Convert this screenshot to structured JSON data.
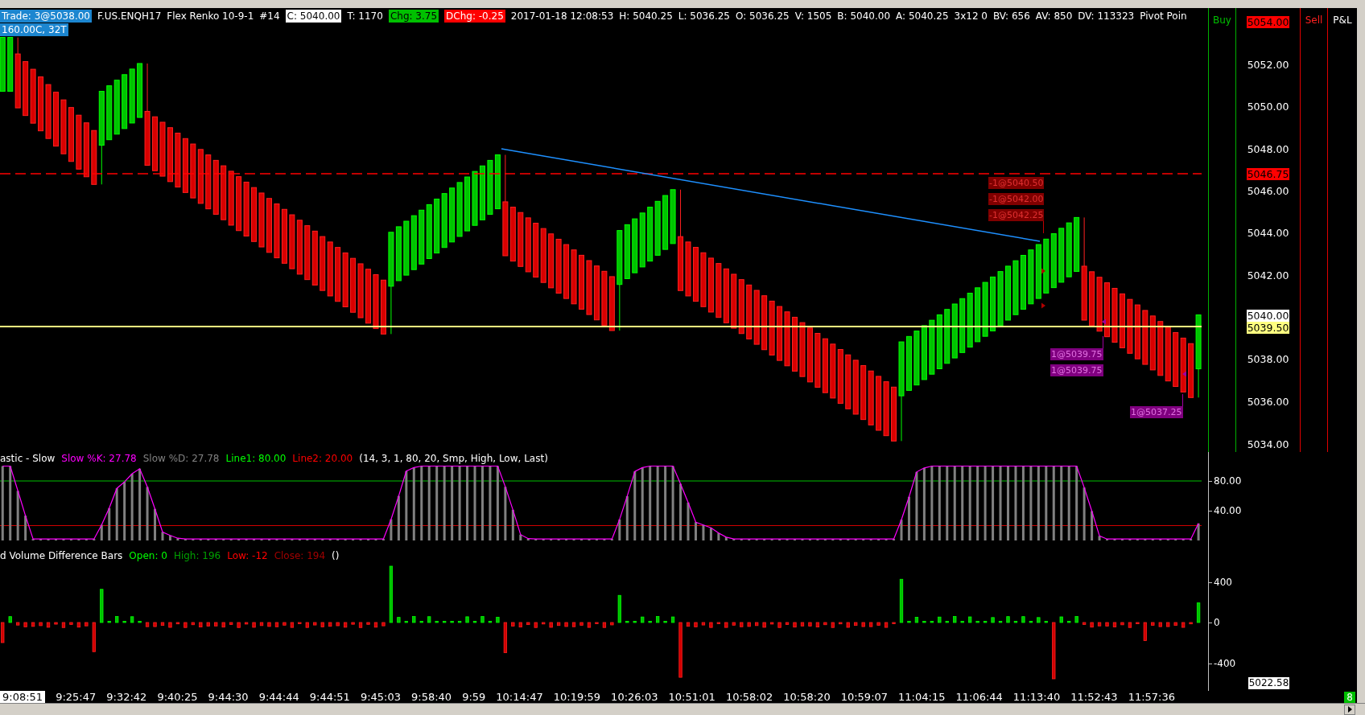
{
  "header": {
    "fields": [
      {
        "text": "Trade: 3@5038.00",
        "kind": "tag",
        "color": "#1c86d0"
      },
      {
        "text": "F.US.ENQH17",
        "kind": "text"
      },
      {
        "text": "Flex Renko 10-9-1",
        "kind": "text"
      },
      {
        "text": "#14",
        "kind": "text"
      },
      {
        "text": "C: 5040.00",
        "kind": "tag",
        "color": "#ffffff"
      },
      {
        "text": "T: 1170",
        "kind": "text"
      },
      {
        "text": "Chg: 3.75",
        "kind": "tag",
        "color": "#00c000"
      },
      {
        "text": "DChg: -0.25",
        "kind": "tag",
        "color": "#ff0000"
      },
      {
        "text": "2017-01-18 12:08:53",
        "kind": "text"
      },
      {
        "text": "H: 5040.25",
        "kind": "text"
      },
      {
        "text": "L: 5036.25",
        "kind": "text"
      },
      {
        "text": "O: 5036.25",
        "kind": "text"
      },
      {
        "text": "V: 1505",
        "kind": "text"
      },
      {
        "text": "B: 5040.00",
        "kind": "text"
      },
      {
        "text": "A: 5040.25",
        "kind": "text"
      },
      {
        "text": "3x12 0",
        "kind": "text"
      },
      {
        "text": "BV: 656",
        "kind": "text"
      },
      {
        "text": "AV: 850",
        "kind": "text"
      },
      {
        "text": "DV: 113323",
        "kind": "text"
      },
      {
        "text": "Pivot Poin",
        "kind": "text"
      }
    ],
    "second_line": {
      "text": "160.00C, 32T",
      "color": "#1c86d0"
    }
  },
  "price_chart": {
    "trade_labels": [
      {
        "kind": "sell",
        "texts": [
          "-1@5040.50",
          "-1@5042.00",
          "-1@5042.25"
        ]
      },
      {
        "kind": "buy",
        "texts": [
          "1@5039.75",
          "1@5039.75"
        ]
      },
      {
        "kind": "buy",
        "texts": [
          "1@5037.25"
        ]
      }
    ]
  },
  "order_columns": {
    "buy": "Buy",
    "sell": "Sell",
    "pnl": "P&L"
  },
  "price_axis": {
    "markers": [
      {
        "text": "5054.00",
        "color": "#ff0000"
      },
      {
        "text": "5046.75",
        "color": "#ff0000"
      },
      {
        "text": "5040.00",
        "color": "#ffffff"
      },
      {
        "text": "5039.50",
        "color": "#ffff80"
      }
    ],
    "ticks": [
      "5052.00",
      "5050.00",
      "5048.00",
      "5046.00",
      "5044.00",
      "5042.00",
      "5038.00",
      "5036.00",
      "5034.00"
    ]
  },
  "stochastic": {
    "legend": [
      {
        "text": "astic - Slow",
        "color": "#ffffff"
      },
      {
        "text": "Slow %K: 27.78",
        "color": "#ff00ff"
      },
      {
        "text": "Slow %D: 27.78",
        "color": "#808080"
      },
      {
        "text": "Line1: 80.00",
        "color": "#00ff00"
      },
      {
        "text": "Line2: 20.00",
        "color": "#ff0000"
      },
      {
        "text": "(14, 3, 1, 80, 20, Smp, High, Low, Last)",
        "color": "#ffffff"
      }
    ],
    "axis": [
      "80.00",
      "40.00"
    ]
  },
  "volume": {
    "legend": [
      {
        "text": "d Volume Difference Bars",
        "color": "#ffffff"
      },
      {
        "text": "Open: 0",
        "color": "#00ff00"
      },
      {
        "text": "High: 196",
        "color": "#00a000"
      },
      {
        "text": "Low: -12",
        "color": "#ff0000"
      },
      {
        "text": "Close: 194",
        "color": "#a00000"
      },
      {
        "text": "()",
        "color": "#ffffff"
      }
    ],
    "axis": [
      "400",
      "0",
      "-400"
    ],
    "cursor_value": "5022.58"
  },
  "time_axis": [
    {
      "text": "9:08:51",
      "highlighted": true
    },
    {
      "text": "9:25:47",
      "highlighted": false
    },
    {
      "text": "9:32:42",
      "highlighted": false
    },
    {
      "text": "9:40:25",
      "highlighted": false
    },
    {
      "text": "9:44:30",
      "highlighted": false
    },
    {
      "text": "9:44:44",
      "highlighted": false
    },
    {
      "text": "9:44:51",
      "highlighted": false
    },
    {
      "text": "9:45:03",
      "highlighted": false
    },
    {
      "text": "9:58:40",
      "highlighted": false
    },
    {
      "text": "9:59",
      "highlighted": false
    },
    {
      "text": "10:14:47",
      "highlighted": false
    },
    {
      "text": "10:19:59",
      "highlighted": false
    },
    {
      "text": "10:26:03",
      "highlighted": false
    },
    {
      "text": "10:51:01",
      "highlighted": false
    },
    {
      "text": "10:58:02",
      "highlighted": false
    },
    {
      "text": "10:58:20",
      "highlighted": false
    },
    {
      "text": "10:59:07",
      "highlighted": false
    },
    {
      "text": "11:04:15",
      "highlighted": false
    },
    {
      "text": "11:06:44",
      "highlighted": false
    },
    {
      "text": "11:13:40",
      "highlighted": false
    },
    {
      "text": "11:52:43",
      "highlighted": false
    },
    {
      "text": "11:57:36",
      "highlighted": false
    }
  ],
  "status_badge": "8"
}
